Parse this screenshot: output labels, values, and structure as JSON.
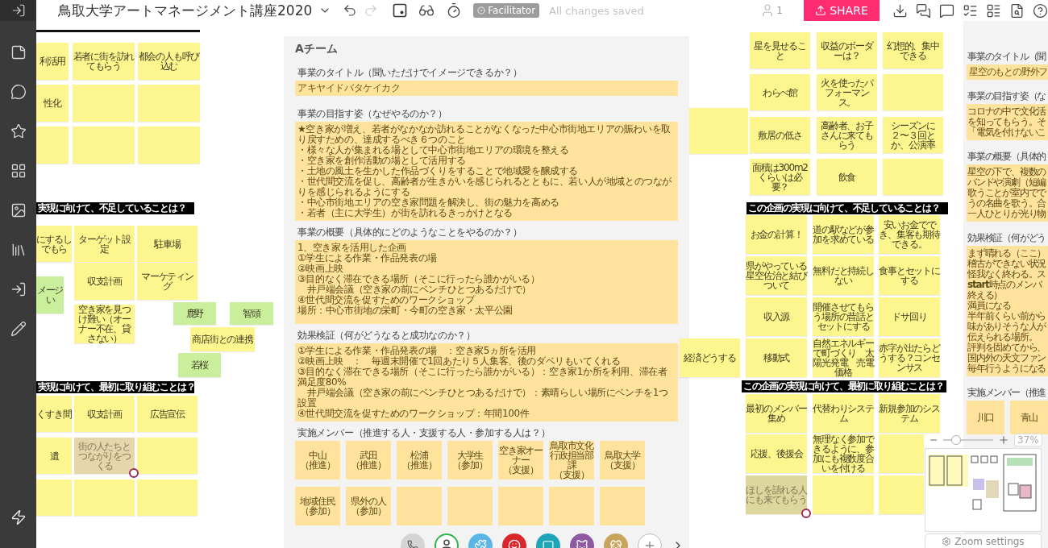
{
  "toolbar": {
    "title": "鳥取大学アートマネージメント講座2020",
    "facilitator": "Facilitator",
    "status": "All changes saved",
    "users": "1",
    "share": "SHARE"
  },
  "left_area": {
    "notes_top": [
      {
        "text": "利活用",
        "color": "#fdf68e"
      },
      {
        "text": "若者に街を訪れてもらう",
        "color": "#fdf68e"
      },
      {
        "text": "都会の人も呼び込む",
        "color": "#fdf68e"
      },
      {
        "text": "性化",
        "color": "#fdf68e"
      },
      {
        "color": "#fdf68e"
      },
      {
        "color": "#fdf68e"
      },
      {
        "color": "#fdf68e"
      },
      {
        "color": "#fdf68e"
      },
      {
        "color": "#fdf68e"
      }
    ],
    "heading_1": "実現に向けて、不足していることは？",
    "notes_middle": [
      {
        "text": "にするしでもら",
        "color": "#fdf68e"
      },
      {
        "text": "ターゲット設定",
        "color": "#fdf68e"
      },
      {
        "text": "駐車場",
        "color": "#fdf68e"
      },
      {
        "text": "メージい",
        "color": "#c9ef9c"
      },
      {
        "text": "収支計画",
        "color": "#fdf68e"
      },
      {
        "text": "マーケティング",
        "color": "#fdf68e"
      },
      {
        "text": "空き家を見つけ難い（オーナー不在、貸さない）",
        "color": "#fdf68e"
      },
      {
        "text": "鹿野",
        "color": "#c9ef9c"
      },
      {
        "text": "智頭",
        "color": "#c9ef9c"
      },
      {
        "text": "商店街との連携",
        "color": "#fdf68e"
      },
      {
        "text": "若桜",
        "color": "#c9ef9c"
      }
    ],
    "heading_2": "実現に向けて、最初に取り組むことは？",
    "notes_bottom": [
      {
        "text": "くすき間",
        "color": "#fdf68e"
      },
      {
        "text": "収支計画",
        "color": "#fdf68e"
      },
      {
        "text": "広告宣伝",
        "color": "#fdf68e"
      },
      {
        "text": "遺",
        "color": "#fdf68e"
      },
      {
        "text": "街の人たちとつながりをつくる",
        "color": "#e6d6aa",
        "commented": true
      },
      {
        "color": "#fdf68e"
      },
      {
        "color": "#fdf68e"
      },
      {
        "color": "#fdf68e"
      },
      {
        "color": "#fdf68e"
      }
    ]
  },
  "team_a": {
    "title": "Aチーム",
    "sections": [
      {
        "kind": "strip",
        "label": "事業のタイトル（聞いただけでイメージできるか？）",
        "text": "アキヤイドバタケイカク"
      },
      {
        "kind": "block",
        "label": "事業の目指す姿（なぜやるのか？）",
        "lines": [
          "★空き家が増え、若者がなかなか訪れることがなくなった中心市街地エリアの賑わいを取り戻すための、達成するべき６つのこと",
          "・様々な人が集まれる場として中心市街地エリアの環境を整える",
          "・空き家を創作活動の場として活用する",
          "・土地の風土を生かした作品づくりをすることで地域愛を醸成する",
          "・世代間交流を促し、高齢者が生きがいを感じられるとともに、若い人が地域とのつながりを感じられるようにする",
          "・中心市街地エリアの空き家問題を解決し、街の魅力を高める",
          "・若者（主に大学生）が街を訪れるきっかけとなる"
        ]
      },
      {
        "kind": "block",
        "label": "事業の概要（具体的にどのようなことをやるのか？）",
        "lines": [
          "1、空き家を活用した企画",
          "①学生による作業・作品発表の場",
          "②映画上映",
          "③目的なく滞在できる場所（そこに行ったら誰かがいる）",
          "　井戸端会議（空き家の前にベンチひとつあるだけで）",
          "④世代間交流を促すためのワークショップ",
          "場所：中心市街地の栄町・今町の空き家・太平公園"
        ]
      },
      {
        "kind": "block",
        "label": "効果検証（何がどうなると成功なのか？）",
        "lines": [
          "①学生による作業・作品発表の場　：空き家5ヵ所を活用",
          "②映画上映　：　毎週末開催で1回あたり５人集客、後のダベリもいてくれる",
          "③目的なく滞在できる場所（そこに行ったら誰かがいる）：空き家1か所を利用、滞在者満足度80%",
          "　井戸端会議（空き家の前にベンチひとつあるだけで）：素晴らしい場所にベンチを1つ設置",
          "④世代間交流を促すためのワークショップ：年間100件"
        ]
      },
      {
        "kind": "members",
        "label": "実施メンバー（推進する人・支援する人・参加する人は？）",
        "notes": [
          {
            "name": "中山",
            "role": "（推進）",
            "color": "#ffe39c"
          },
          {
            "name": "武田",
            "role": "（推進）",
            "color": "#ffe39c"
          },
          {
            "name": "松浦",
            "role": "（推進）",
            "color": "#ffe39c"
          },
          {
            "name": "大学生",
            "role": "（参加）",
            "color": "#ffe39c"
          },
          {
            "name": "空き家オーナー",
            "role": "（支援）",
            "color": "#ffe39c"
          },
          {
            "name": "鳥取市文化行政担当部課",
            "role": "（支援）",
            "color": "#ffe39c"
          },
          {
            "name": "鳥取大学",
            "role": "（支援）",
            "color": "#ffe39c"
          },
          {
            "name": "地域住民",
            "role": "（参加）",
            "color": "#ffe39c"
          },
          {
            "name": "県外の人",
            "role": "（参加）",
            "color": "#ffe39c"
          },
          {
            "color": "#ffe39c"
          },
          {
            "color": "#ffe39c"
          },
          {
            "color": "#ffe39c"
          },
          {
            "color": "#ffe39c"
          },
          {
            "color": "#ffe39c"
          }
        ]
      }
    ]
  },
  "right_area": {
    "notes_top": [
      {
        "text": "星を見せること",
        "color": "#fdf68e"
      },
      {
        "text": "収益のボーダーは？",
        "color": "#fdf68e"
      },
      {
        "text": "幻想的、集中できる",
        "color": "#fdf68e"
      },
      {
        "text": "わらべ館",
        "color": "#fdf68e"
      },
      {
        "text": "火を使ったパフォーマンス。",
        "color": "#fdf68e"
      },
      {
        "color": "#fdf68e"
      },
      {
        "color": "#fdf68e"
      },
      {
        "text": "敷居の低さ",
        "color": "#fdf68e"
      },
      {
        "text": "高齢者、お子さんに来てもらう",
        "color": "#fdf68e"
      },
      {
        "text": "シーズンに２〜３回とか、公演率",
        "color": "#fdf68e"
      },
      {
        "text": "面積は300m2くらいは必要？",
        "color": "#fdf68e"
      },
      {
        "text": "飲食",
        "color": "#fdf68e"
      },
      {
        "color": "#fdf68e"
      }
    ],
    "heading_1": "この企画の実現に向けて、不足していることは？",
    "notes_middle": [
      {
        "text": "お金の計算！",
        "color": "#fdf68e"
      },
      {
        "text": "道の駅などが参加を求めている",
        "color": "#fdf68e"
      },
      {
        "text": "安いお金ででき、集客も期待できる。",
        "color": "#fdf68e"
      },
      {
        "text": "県がやっている星空佐治と結びついて",
        "color": "#fdf68e"
      },
      {
        "text": "無料だと持続しない",
        "color": "#fdf68e"
      },
      {
        "text": "食事とセットにする",
        "color": "#fdf68e"
      },
      {
        "text": "収入源",
        "color": "#fdf68e"
      },
      {
        "text": "開催させてもらう場所の昔話とセットにする",
        "color": "#fdf68e"
      },
      {
        "text": "ドサ回り",
        "color": "#fdf68e"
      },
      {
        "text": "経済どうする",
        "color": "#fdf68e"
      },
      {
        "text": "移動式",
        "color": "#fdf68e"
      },
      {
        "text": "自然エネルギーで町づくり　太陽光発電　売電価格",
        "color": "#fdf68e"
      },
      {
        "text": "赤字が出たらどうする？コンセンサス",
        "color": "#fdf68e"
      }
    ],
    "heading_2": "この企画の実現に向けて、最初に取り組むことは？",
    "notes_bottom": [
      {
        "text": "最初のメンバー集め",
        "color": "#fdf68e"
      },
      {
        "text": "代替わりシステム",
        "color": "#fdf68e"
      },
      {
        "text": "新規参加のシステム",
        "color": "#fdf68e"
      },
      {
        "text": "応援、後援会",
        "color": "#fdf68e"
      },
      {
        "text": "無理なく参加できるように、参加にも複数度合いを付ける",
        "color": "#fdf68e"
      },
      {
        "color": "#fdf68e"
      },
      {
        "text": "ほしを語れる人にも来てもらう",
        "color": "#dcd79c",
        "commented": true
      },
      {
        "color": "#fdf68e"
      },
      {
        "color": "#fdf68e"
      }
    ]
  },
  "team_b": {
    "sections": [
      {
        "kind": "strip",
        "label": "事業のタイトル（聞",
        "text": "星空のもとの野外フ"
      },
      {
        "kind": "block",
        "label": "事業の目指す姿（な",
        "lines": [
          "コロナの中で文化活",
          "を知ってもらう。そ",
          "「電気を付けないこ"
        ]
      },
      {
        "kind": "block",
        "label": "事業の概要（具体的",
        "lines": [
          "星空の下で、複数の",
          "バンドや演劇（短編",
          "歌うことが室内でで",
          "うの名曲を歌う。合",
          "一人ひとりが光り物"
        ]
      },
      {
        "kind": "block",
        "label": "効果検証（何がどう",
        "lines": [
          "まず晴れる（ここ）",
          "稽古ができない状況",
          "怪我なく終わる。ス",
          "**start**時点のメンバ",
          "終える）",
          "満員になる",
          "半年前くらい前から",
          "味がありそうな人が",
          "伝えられる場所。",
          "評判を固めてから、",
          "国内外の天文ファン",
          "毎年行うようになる"
        ]
      },
      {
        "kind": "members",
        "label": "実施メンバー（推進",
        "notes": [
          {
            "name": "川口",
            "color": "#ffe39c"
          },
          {
            "name": "青山",
            "color": "#ffe39c"
          }
        ]
      }
    ]
  },
  "zoom": {
    "level": 0.2,
    "reading": "37%",
    "settings": "Zoom settings"
  }
}
